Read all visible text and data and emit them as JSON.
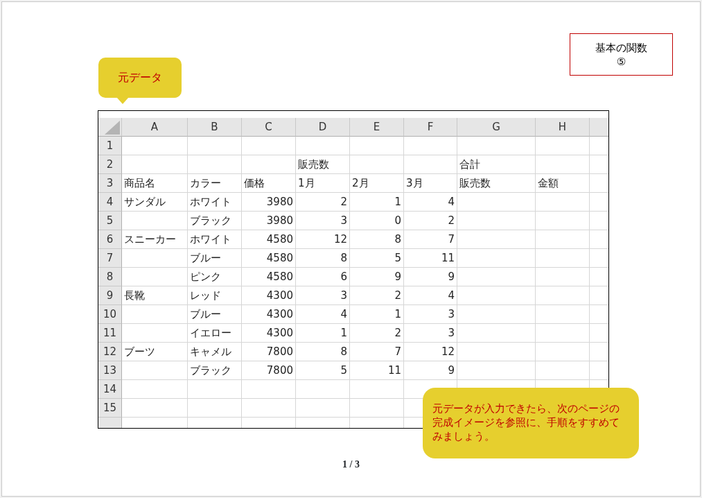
{
  "title_box": {
    "lines": [
      "基本の関数",
      "⑤"
    ]
  },
  "callouts": [
    {
      "kind": "label",
      "text": "元データ"
    },
    {
      "kind": "note",
      "text": "元データが入力できたら、次のページの完成イメージを参照に、手順をすすめてみましょう。"
    }
  ],
  "sheet": {
    "columns": [
      "A",
      "B",
      "C",
      "D",
      "E",
      "F",
      "G",
      "H"
    ],
    "rows": [
      {
        "number": "1",
        "cells": [
          null,
          null,
          null,
          null,
          null,
          null,
          null,
          null
        ]
      },
      {
        "number": "2",
        "cells": [
          null,
          null,
          null,
          {
            "kind": "text",
            "text": "販売数"
          },
          null,
          null,
          {
            "kind": "text",
            "text": "合計"
          },
          null
        ]
      },
      {
        "number": "3",
        "cells": [
          {
            "kind": "text",
            "text": "商品名"
          },
          {
            "kind": "text",
            "text": "カラー"
          },
          {
            "kind": "text",
            "text": "価格"
          },
          {
            "kind": "text",
            "text": "1月"
          },
          {
            "kind": "text",
            "text": "2月"
          },
          {
            "kind": "text",
            "text": "3月"
          },
          {
            "kind": "text",
            "text": "販売数"
          },
          {
            "kind": "text",
            "text": "金額"
          }
        ]
      },
      {
        "number": "4",
        "cells": [
          {
            "kind": "text",
            "text": "サンダル"
          },
          {
            "kind": "text",
            "text": "ホワイト"
          },
          {
            "kind": "number",
            "text": "3980"
          },
          {
            "kind": "number",
            "text": "2"
          },
          {
            "kind": "number",
            "text": "1"
          },
          {
            "kind": "number",
            "text": "4"
          },
          null,
          null
        ]
      },
      {
        "number": "5",
        "cells": [
          null,
          {
            "kind": "text",
            "text": "ブラック"
          },
          {
            "kind": "number",
            "text": "3980"
          },
          {
            "kind": "number",
            "text": "3"
          },
          {
            "kind": "number",
            "text": "0"
          },
          {
            "kind": "number",
            "text": "2"
          },
          null,
          null
        ]
      },
      {
        "number": "6",
        "cells": [
          {
            "kind": "text",
            "text": "スニーカー"
          },
          {
            "kind": "text",
            "text": "ホワイト"
          },
          {
            "kind": "number",
            "text": "4580"
          },
          {
            "kind": "number",
            "text": "12"
          },
          {
            "kind": "number",
            "text": "8"
          },
          {
            "kind": "number",
            "text": "7"
          },
          null,
          null
        ]
      },
      {
        "number": "7",
        "cells": [
          null,
          {
            "kind": "text",
            "text": "ブルー"
          },
          {
            "kind": "number",
            "text": "4580"
          },
          {
            "kind": "number",
            "text": "8"
          },
          {
            "kind": "number",
            "text": "5"
          },
          {
            "kind": "number",
            "text": "11"
          },
          null,
          null
        ]
      },
      {
        "number": "8",
        "cells": [
          null,
          {
            "kind": "text",
            "text": "ピンク"
          },
          {
            "kind": "number",
            "text": "4580"
          },
          {
            "kind": "number",
            "text": "6"
          },
          {
            "kind": "number",
            "text": "9"
          },
          {
            "kind": "number",
            "text": "9"
          },
          null,
          null
        ]
      },
      {
        "number": "9",
        "cells": [
          {
            "kind": "text",
            "text": "長靴"
          },
          {
            "kind": "text",
            "text": "レッド"
          },
          {
            "kind": "number",
            "text": "4300"
          },
          {
            "kind": "number",
            "text": "3"
          },
          {
            "kind": "number",
            "text": "2"
          },
          {
            "kind": "number",
            "text": "4"
          },
          null,
          null
        ]
      },
      {
        "number": "10",
        "cells": [
          null,
          {
            "kind": "text",
            "text": "ブルー"
          },
          {
            "kind": "number",
            "text": "4300"
          },
          {
            "kind": "number",
            "text": "4"
          },
          {
            "kind": "number",
            "text": "1"
          },
          {
            "kind": "number",
            "text": "3"
          },
          null,
          null
        ]
      },
      {
        "number": "11",
        "cells": [
          null,
          {
            "kind": "text",
            "text": "イエロー"
          },
          {
            "kind": "number",
            "text": "4300"
          },
          {
            "kind": "number",
            "text": "1"
          },
          {
            "kind": "number",
            "text": "2"
          },
          {
            "kind": "number",
            "text": "3"
          },
          null,
          null
        ]
      },
      {
        "number": "12",
        "cells": [
          {
            "kind": "text",
            "text": "ブーツ"
          },
          {
            "kind": "text",
            "text": "キャメル"
          },
          {
            "kind": "number",
            "text": "7800"
          },
          {
            "kind": "number",
            "text": "8"
          },
          {
            "kind": "number",
            "text": "7"
          },
          {
            "kind": "number",
            "text": "12"
          },
          null,
          null
        ]
      },
      {
        "number": "13",
        "cells": [
          null,
          {
            "kind": "text",
            "text": "ブラック"
          },
          {
            "kind": "number",
            "text": "7800"
          },
          {
            "kind": "number",
            "text": "5"
          },
          {
            "kind": "number",
            "text": "11"
          },
          {
            "kind": "number",
            "text": "9"
          },
          null,
          null
        ]
      },
      {
        "number": "14",
        "cells": [
          null,
          null,
          null,
          null,
          null,
          null,
          null,
          null
        ]
      },
      {
        "number": "15",
        "cells": [
          null,
          null,
          null,
          null,
          null,
          null,
          null,
          null
        ]
      }
    ]
  },
  "page_number": "1 / 3"
}
